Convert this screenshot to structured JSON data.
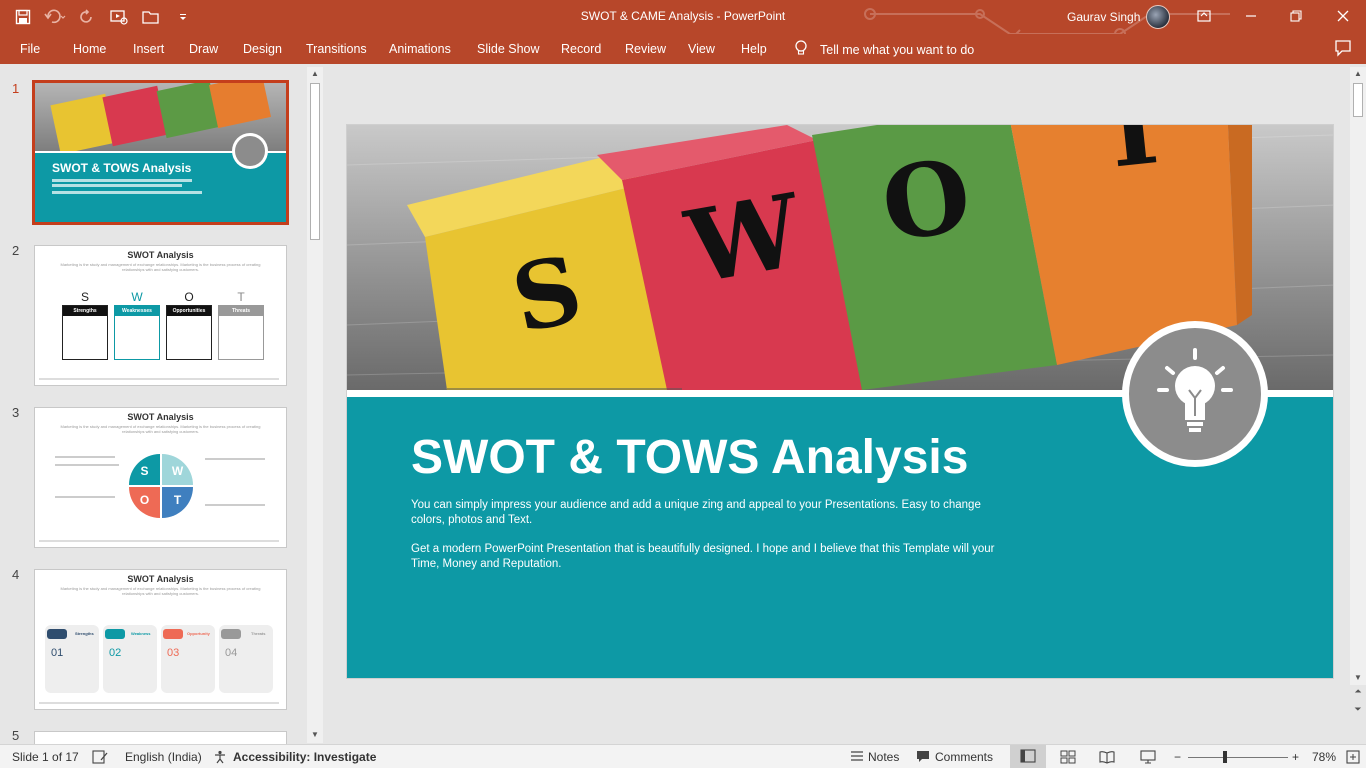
{
  "window": {
    "title": "SWOT & CAME Analysis  -  PowerPoint",
    "user_name": "Gaurav Singh"
  },
  "ribbon": {
    "tabs": [
      "File",
      "Home",
      "Insert",
      "Draw",
      "Design",
      "Transitions",
      "Animations",
      "Slide Show",
      "Record",
      "Review",
      "View",
      "Help"
    ],
    "tell_me": "Tell me what you want to do"
  },
  "thumbnails": [
    {
      "number": "1",
      "title": "SWOT & TOWS Analysis"
    },
    {
      "number": "2",
      "title": "SWOT Analysis",
      "subtitle": "Marketing is the study and management of exchange relationships. Marketing is the business process of creating relationships with and satisfying customers.",
      "cards": [
        "Strengths",
        "Weaknesses",
        "Opportunities",
        "Threats"
      ],
      "letters": [
        "S",
        "W",
        "O",
        "T"
      ]
    },
    {
      "number": "3",
      "title": "SWOT Analysis",
      "subtitle": "Marketing is the study and management of exchange relationships. Marketing is the business process of creating relationships with and satisfying customers.",
      "letters": [
        "S",
        "W",
        "O",
        "T"
      ]
    },
    {
      "number": "4",
      "title": "SWOT Analysis",
      "subtitle": "Marketing is the study and management of exchange relationships. Marketing is the business process of creating relationships with and satisfying customers.",
      "cards": [
        "Strengths",
        "Weakness",
        "Opportunity",
        "Threats"
      ],
      "numbers": [
        "01",
        "02",
        "03",
        "04"
      ]
    },
    {
      "number": "5"
    }
  ],
  "slide": {
    "letters": [
      "S",
      "W",
      "O",
      "T"
    ],
    "heading": "SWOT & TOWS Analysis",
    "body1": "You can simply impress your audience and add a unique zing and appeal to your Presentations. Easy to change colors, photos and Text.",
    "body2": "Get a modern PowerPoint  Presentation that is beautifully designed. I hope and I believe that this Template will your Time, Money and Reputation."
  },
  "status": {
    "slide_info": "Slide 1 of 17",
    "language": "English (India)",
    "accessibility": "Accessibility: Investigate",
    "notes": "Notes",
    "comments": "Comments",
    "zoom": "78%"
  },
  "colors": {
    "accent": "#b7472a",
    "band": "#0d99a5",
    "selected": "#c43e1c"
  }
}
